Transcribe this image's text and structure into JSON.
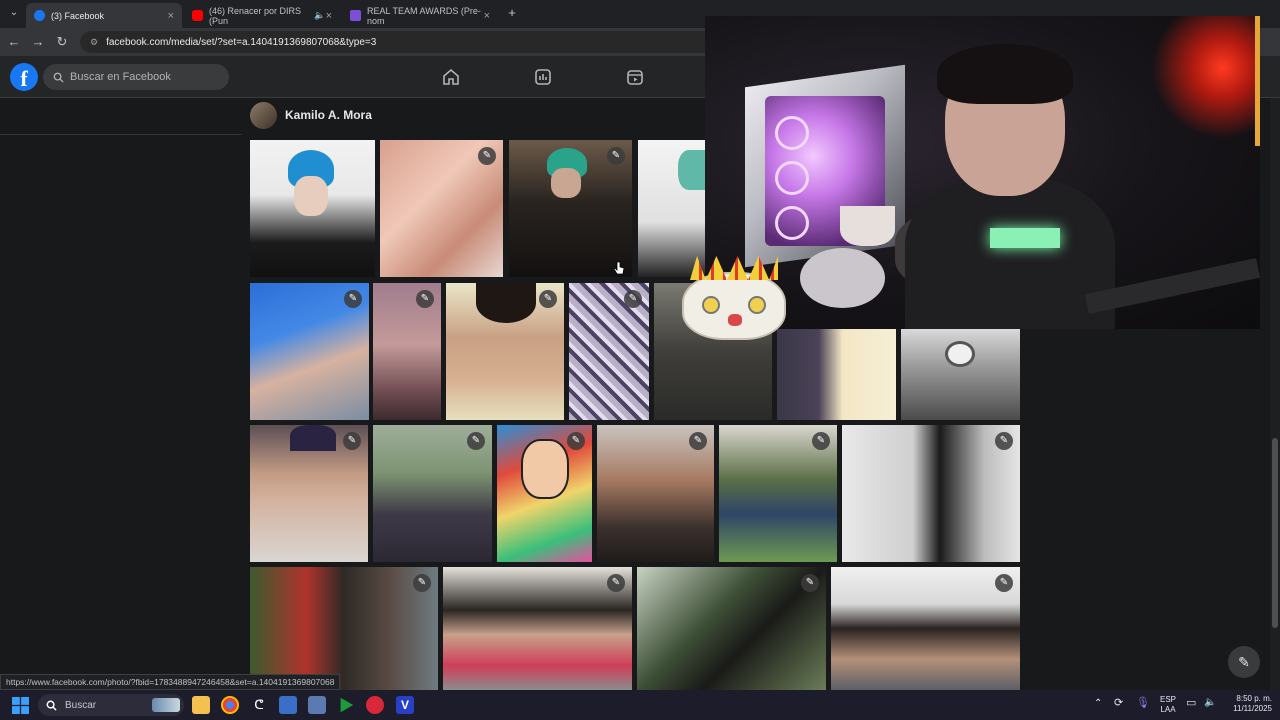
{
  "browser": {
    "tabs": [
      {
        "title": "(3) Facebook",
        "favicon_color": "#1877f2",
        "active": true
      },
      {
        "title": "(46) Renacer por DIRS (Pun",
        "favicon_color": "#ff0000",
        "active": false
      },
      {
        "title": "REAL TEAM AWARDS (Pre-nom",
        "favicon_color": "#7b4fd6",
        "active": false
      }
    ],
    "new_tab_label": "+",
    "url": "facebook.com/media/set/?set=a.1404191369807068&type=3"
  },
  "fb": {
    "search_placeholder": "Buscar en Facebook",
    "owner_name": "Kamilo A. Mora",
    "edit_icon": "pencil-icon"
  },
  "status_url": "https://www.facebook.com/photo/?fbid=1783488947246458&set=a.1404191369807068",
  "taskbar": {
    "search_placeholder": "Buscar",
    "lang_line1": "ESP",
    "lang_line2": "LAA",
    "time": "8:50 p. m.",
    "date": "11/11/2025"
  },
  "colors": {
    "fb_blue": "#1877f2",
    "page_bg": "#18191a",
    "header_bg": "#242526"
  }
}
